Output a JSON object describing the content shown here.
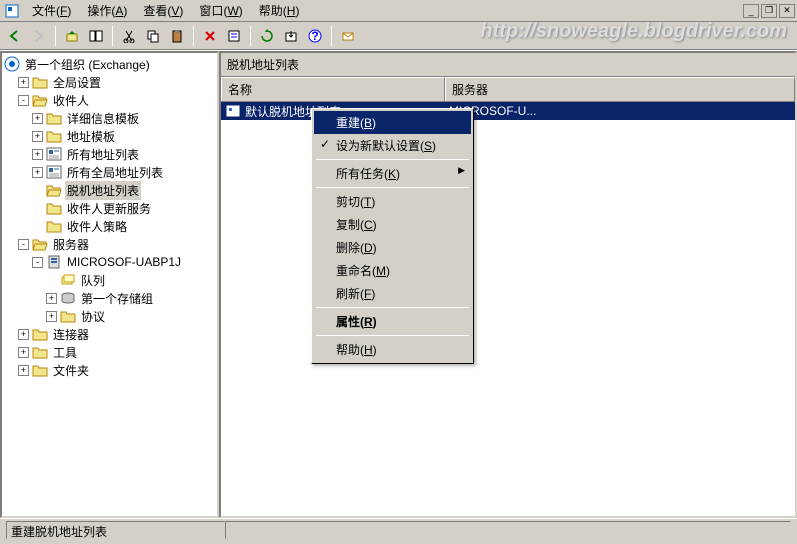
{
  "menubar": {
    "items": [
      {
        "label": "文件",
        "accel": "F"
      },
      {
        "label": "操作",
        "accel": "A"
      },
      {
        "label": "查看",
        "accel": "V"
      },
      {
        "label": "窗口",
        "accel": "W"
      },
      {
        "label": "帮助",
        "accel": "H"
      }
    ]
  },
  "tree": {
    "root": {
      "label": "第一个组织 (Exchange)"
    },
    "nodes": [
      {
        "indent": 1,
        "expander": "+",
        "icon": "folder",
        "label": "全局设置"
      },
      {
        "indent": 1,
        "expander": "-",
        "icon": "folder-open",
        "label": "收件人"
      },
      {
        "indent": 2,
        "expander": "+",
        "icon": "folder",
        "label": "详细信息模板"
      },
      {
        "indent": 2,
        "expander": "+",
        "icon": "folder",
        "label": "地址模板"
      },
      {
        "indent": 2,
        "expander": "+",
        "icon": "addrlist",
        "label": "所有地址列表"
      },
      {
        "indent": 2,
        "expander": "+",
        "icon": "addrlist",
        "label": "所有全局地址列表"
      },
      {
        "indent": 2,
        "expander": "",
        "icon": "folder-open",
        "label": "脱机地址列表",
        "selected": true
      },
      {
        "indent": 2,
        "expander": "",
        "icon": "folder",
        "label": "收件人更新服务"
      },
      {
        "indent": 2,
        "expander": "",
        "icon": "folder",
        "label": "收件人策略"
      },
      {
        "indent": 1,
        "expander": "-",
        "icon": "folder-open",
        "label": "服务器"
      },
      {
        "indent": 2,
        "expander": "-",
        "icon": "server",
        "label": "MICROSOF-UABP1J"
      },
      {
        "indent": 3,
        "expander": "",
        "icon": "queue",
        "label": "队列"
      },
      {
        "indent": 3,
        "expander": "+",
        "icon": "storage",
        "label": "第一个存储组"
      },
      {
        "indent": 3,
        "expander": "+",
        "icon": "folder",
        "label": "协议"
      },
      {
        "indent": 1,
        "expander": "+",
        "icon": "folder",
        "label": "连接器"
      },
      {
        "indent": 1,
        "expander": "+",
        "icon": "folder",
        "label": "工具"
      },
      {
        "indent": 1,
        "expander": "+",
        "icon": "folder",
        "label": "文件夹"
      }
    ]
  },
  "content": {
    "title": "脱机地址列表",
    "columns": [
      "名称",
      "服务器"
    ],
    "rows": [
      {
        "name": "默认脱机地址列表",
        "server": "MICROSOF-U..."
      }
    ]
  },
  "context_menu": {
    "items": [
      {
        "label": "重建",
        "accel": "B",
        "highlight": true
      },
      {
        "label": "设为新默认设置",
        "accel": "S",
        "check": true
      },
      {
        "sep": true
      },
      {
        "label": "所有任务",
        "accel": "K",
        "submenu": true
      },
      {
        "sep": true
      },
      {
        "label": "剪切",
        "accel": "T"
      },
      {
        "label": "复制",
        "accel": "C"
      },
      {
        "label": "删除",
        "accel": "D"
      },
      {
        "label": "重命名",
        "accel": "M"
      },
      {
        "label": "刷新",
        "accel": "F"
      },
      {
        "sep": true
      },
      {
        "label": "属性",
        "accel": "R",
        "bold": true
      },
      {
        "sep": true
      },
      {
        "label": "帮助",
        "accel": "H"
      }
    ]
  },
  "statusbar": {
    "text": "重建脱机地址列表"
  },
  "watermark": "http://snoweagle.blogdriver.com"
}
